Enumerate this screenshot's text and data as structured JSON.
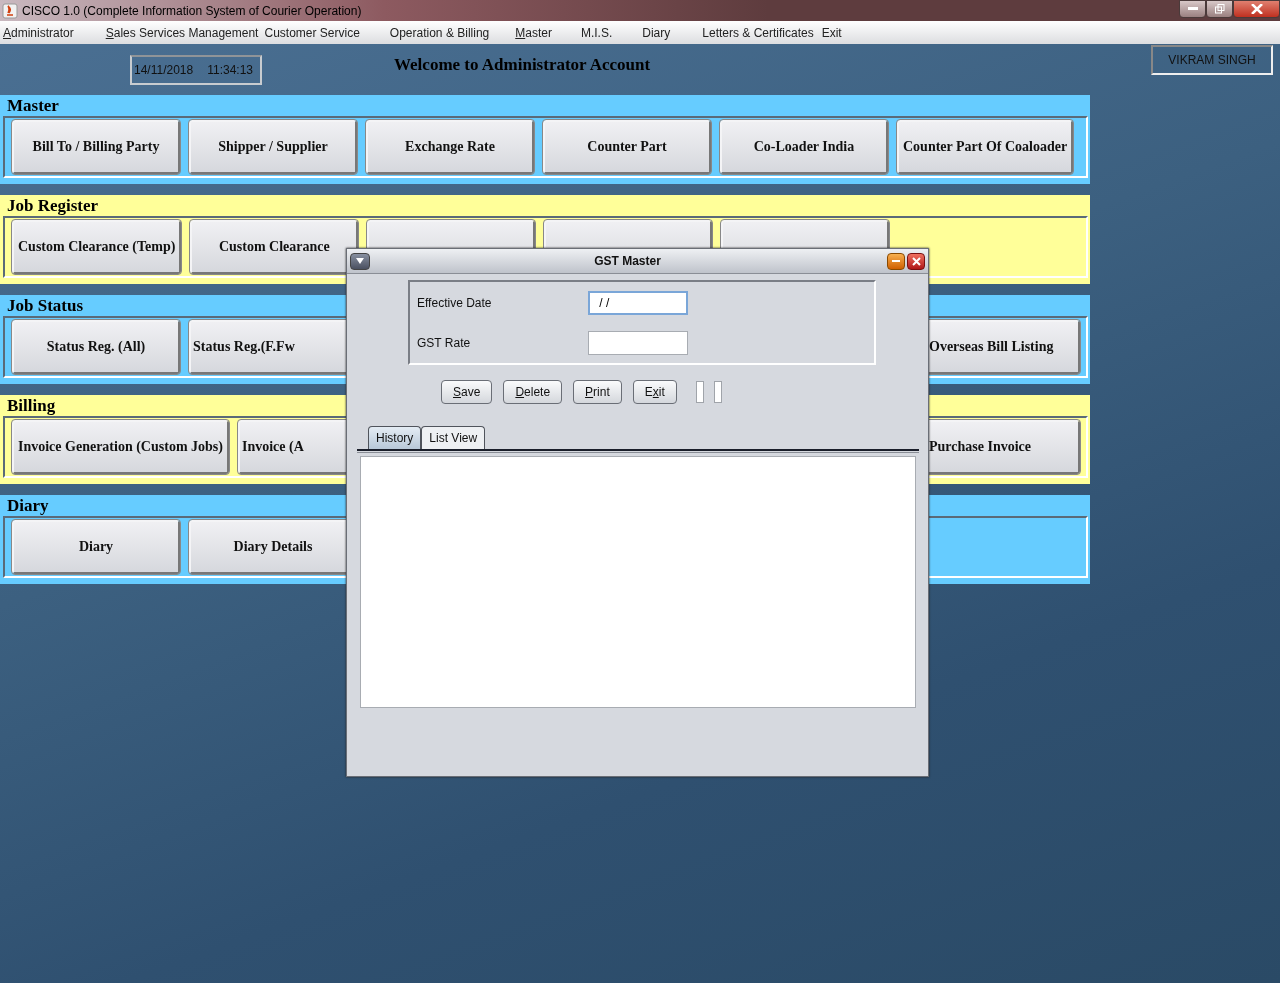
{
  "window": {
    "title": "CISCO 1.0 (Complete Information System of Courier Operation)"
  },
  "menu": [
    {
      "mnemonic": "A",
      "after": "dministrator"
    },
    {
      "mnemonic": "S",
      "after": "ales Services Management"
    },
    {
      "after": "Customer Service"
    },
    {
      "after": "Operation & Billing"
    },
    {
      "mnemonic": "M",
      "after": "aster"
    },
    {
      "after": "M.I.S."
    },
    {
      "after": "Diary"
    },
    {
      "after": "Letters & Certificates"
    },
    {
      "after": "Exit"
    }
  ],
  "header": {
    "date": "14/11/2018",
    "time": "11:34:13",
    "welcome": "Welcome to Administrator Account",
    "user": "VIKRAM SINGH"
  },
  "sections": [
    {
      "title": "Master",
      "color": "#66ccff",
      "buttons": [
        {
          "label": "Bill To / Billing Party",
          "kind": "full"
        },
        {
          "label": "Shipper / Supplier",
          "kind": "full"
        },
        {
          "label": "Exchange Rate",
          "kind": "full"
        },
        {
          "label": "Counter Part",
          "kind": "full"
        },
        {
          "label": "Co-Loader India",
          "kind": "full"
        },
        {
          "label": "Counter Part Of Coaloader",
          "kind": "full"
        }
      ]
    },
    {
      "title": "Job Register",
      "color": "#ffff99",
      "buttons": [
        {
          "label": "Custom Clearance (Temp)",
          "kind": "full"
        },
        {
          "label": "Custom Clearance",
          "kind": "full"
        },
        {
          "kind": "full"
        },
        {
          "kind": "full"
        },
        {
          "kind": "full"
        }
      ]
    },
    {
      "title": "Job Status",
      "color": "#66ccff",
      "buttons": [
        {
          "label": "Status Reg. (All)",
          "kind": "full"
        },
        {
          "label": "Status Reg.(F.Fw",
          "kind": "cut-right"
        },
        {
          "label": "Overseas Bill Listing",
          "kind": "cut-left"
        }
      ]
    },
    {
      "title": "Billing",
      "color": "#ffff99",
      "buttons": [
        {
          "label": "Invoice Generation (Custom Jobs)",
          "kind": "full"
        },
        {
          "label": "Invoice (A",
          "kind": "cut-right"
        },
        {
          "label": "Purchase Invoice",
          "kind": "cut-left"
        }
      ]
    },
    {
      "title": "Diary",
      "color": "#66ccff",
      "buttons": [
        {
          "label": "Diary",
          "kind": "full"
        },
        {
          "label": "Diary Details",
          "kind": "full"
        }
      ]
    }
  ],
  "dialog": {
    "title": "GST Master",
    "fields": [
      {
        "label": "Effective Date",
        "value": " / /",
        "focused": true
      },
      {
        "label": "GST Rate",
        "focused": false
      }
    ],
    "buttons": [
      {
        "mnemonic": "S",
        "after": "ave"
      },
      {
        "mnemonic": "D",
        "after": "elete"
      },
      {
        "mnemonic": "P",
        "after": "rint"
      },
      {
        "before": "E",
        "mnemonic": "x",
        "after": "it"
      }
    ],
    "tabs": [
      {
        "label": "History",
        "selected": true
      },
      {
        "label": "List View",
        "selected": false
      }
    ]
  }
}
